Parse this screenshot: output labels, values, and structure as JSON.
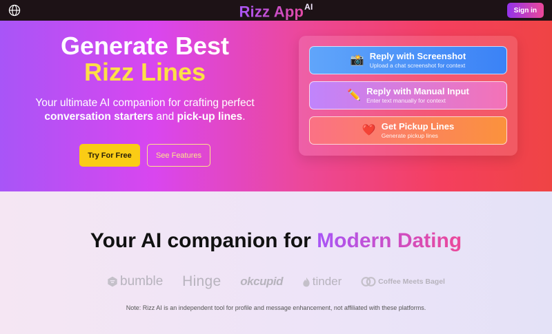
{
  "nav": {
    "brand": "Rizz App",
    "brand_sup": "AI",
    "signin_label": "Sign in",
    "language_icon": "globe-icon"
  },
  "hero": {
    "title_line1": "Generate Best",
    "title_line2": "Rizz Lines",
    "subtitle_part1": "Your ultimate AI companion for crafting perfect",
    "subtitle_bold1": "conversation starters",
    "subtitle_and": " and ",
    "subtitle_bold2": "pick-up lines",
    "subtitle_end": ".",
    "try_label": "Try For Free",
    "features_label": "See Features"
  },
  "options": [
    {
      "icon": "camera-icon",
      "glyph": "📸",
      "title": "Reply with Screenshot",
      "desc": "Upload a chat screenshot for context"
    },
    {
      "icon": "pencil-icon",
      "glyph": "✏️",
      "title": "Reply with Manual Input",
      "desc": "Enter text manually for context"
    },
    {
      "icon": "heart-icon",
      "glyph": "❤️",
      "title": "Get Pickup Lines",
      "desc": "Generate pickup lines"
    }
  ],
  "platforms": {
    "heading_plain": "Your AI companion for ",
    "heading_accent": "Modern Dating",
    "logos": [
      "bumble",
      "Hinge",
      "okcupid",
      "tinder",
      "Coffee Meets Bagel"
    ],
    "note": "Note: Rizz AI is an independent tool for profile and message enhancement, not affiliated with these platforms."
  },
  "colors": {
    "brand_purple": "#a855f7",
    "brand_pink": "#ec4899",
    "accent_yellow": "#fde047",
    "nav_bg": "#1d1216"
  }
}
